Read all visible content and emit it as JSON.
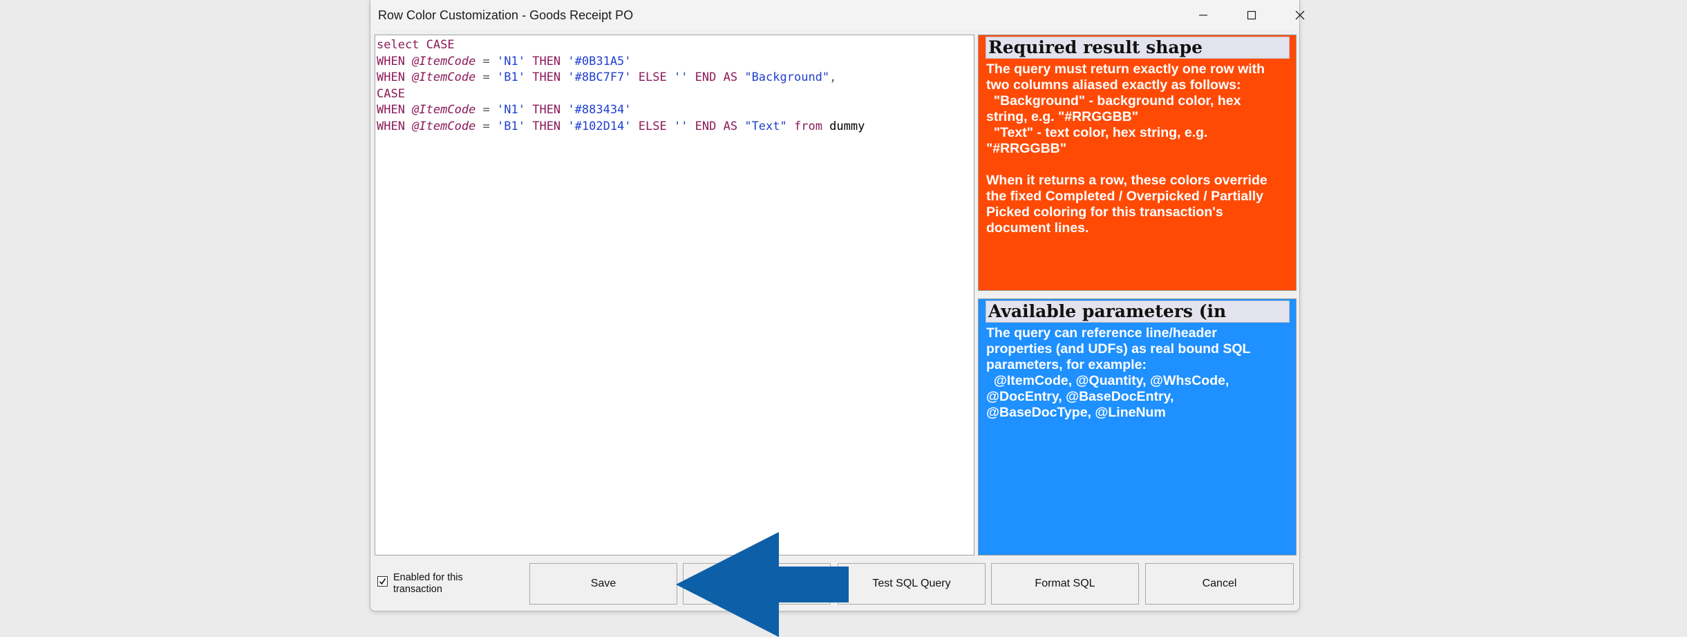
{
  "window": {
    "title": "Row Color Customization - Goods Receipt PO",
    "controls": {
      "minimize": "minimize-icon",
      "maximize": "maximize-icon",
      "close": "close-icon"
    }
  },
  "editor": {
    "lines": [
      [
        {
          "t": "kw",
          "v": "select CASE"
        }
      ],
      [
        {
          "t": "kw",
          "v": "WHEN "
        },
        {
          "t": "pr",
          "v": "@ItemCode"
        },
        {
          "t": "op",
          "v": " = "
        },
        {
          "t": "st",
          "v": "'N1'"
        },
        {
          "t": "kw",
          "v": " THEN "
        },
        {
          "t": "st",
          "v": "'#0B31A5'"
        }
      ],
      [
        {
          "t": "kw",
          "v": "WHEN "
        },
        {
          "t": "pr",
          "v": "@ItemCode"
        },
        {
          "t": "op",
          "v": " = "
        },
        {
          "t": "st",
          "v": "'B1'"
        },
        {
          "t": "kw",
          "v": " THEN "
        },
        {
          "t": "st",
          "v": "'#8BC7F7'"
        },
        {
          "t": "kw",
          "v": " ELSE "
        },
        {
          "t": "st",
          "v": "''"
        },
        {
          "t": "kw",
          "v": " END AS "
        },
        {
          "t": "st",
          "v": "\"Background\""
        },
        {
          "t": "op",
          "v": ","
        }
      ],
      [
        {
          "t": "kw",
          "v": "CASE"
        }
      ],
      [
        {
          "t": "kw",
          "v": "WHEN "
        },
        {
          "t": "pr",
          "v": "@ItemCode"
        },
        {
          "t": "op",
          "v": " = "
        },
        {
          "t": "st",
          "v": "'N1'"
        },
        {
          "t": "kw",
          "v": " THEN "
        },
        {
          "t": "st",
          "v": "'#883434'"
        }
      ],
      [
        {
          "t": "kw",
          "v": "WHEN "
        },
        {
          "t": "pr",
          "v": "@ItemCode"
        },
        {
          "t": "op",
          "v": " = "
        },
        {
          "t": "st",
          "v": "'B1'"
        },
        {
          "t": "kw",
          "v": " THEN "
        },
        {
          "t": "st",
          "v": "'#102D14'"
        },
        {
          "t": "kw",
          "v": " ELSE "
        },
        {
          "t": "st",
          "v": "''"
        },
        {
          "t": "kw",
          "v": " END AS "
        },
        {
          "t": "st",
          "v": "\"Text\""
        },
        {
          "t": "kw",
          "v": " from "
        },
        {
          "t": "tx",
          "v": "dummy"
        }
      ]
    ]
  },
  "panels": {
    "result": {
      "title": "Required result shape",
      "color": "#ff4a06",
      "p1_lines": [
        "The query must return exactly one row with",
        "two columns aliased exactly as follows:",
        "  \"Background\" - background color, hex",
        "string, e.g. \"#RRGGBB\"",
        "  \"Text\" - text color, hex string, e.g.",
        "\"#RRGGBB\""
      ],
      "p2_lines": [
        "When it returns a row, these colors override",
        "the fixed Completed / Overpicked / Partially",
        "Picked coloring for this transaction's",
        "document lines."
      ]
    },
    "params": {
      "title": "Available parameters (in",
      "color": "#1e90ff",
      "lines": [
        "The query can reference line/header",
        "properties (and UDFs) as real bound SQL",
        "parameters, for example:",
        "  @ItemCode, @Quantity, @WhsCode,",
        "@DocEntry, @BaseDocEntry,",
        "@BaseDocType, @LineNum"
      ]
    }
  },
  "footer": {
    "checkbox_label": "Enabled for this transaction",
    "checkbox_checked": true,
    "save": "Save",
    "hidden_button": "",
    "test": "Test SQL Query",
    "format": "Format SQL",
    "cancel": "Cancel"
  },
  "overlay": {
    "arrow_color": "#0d5fa8",
    "arrow_icon": "left-arrow-icon"
  }
}
